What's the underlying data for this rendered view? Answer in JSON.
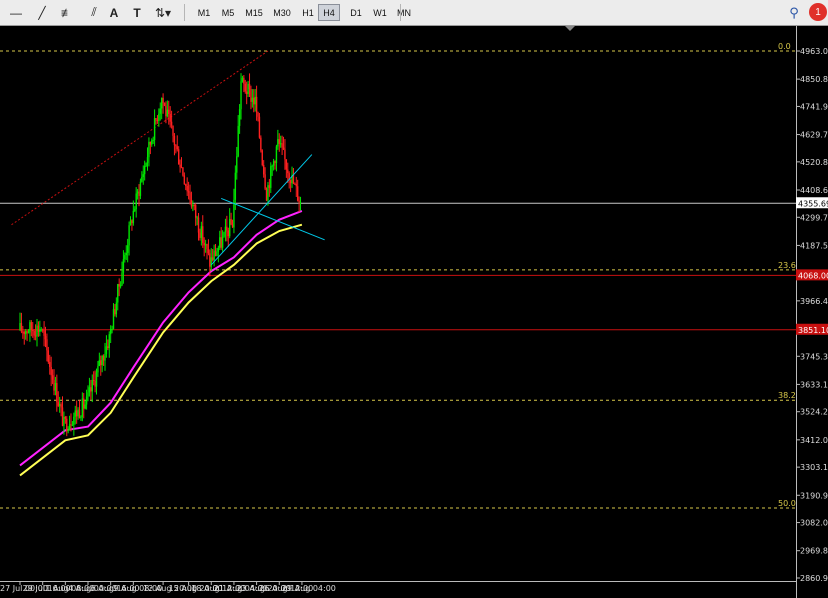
{
  "toolbar": {
    "timeframes": [
      "M1",
      "M5",
      "M15",
      "M30",
      "H1",
      "H4",
      "D1",
      "W1",
      "MN"
    ],
    "active_timeframe": "H4",
    "notification_count": "1"
  },
  "chart_data": {
    "type": "candlestick",
    "symbol_price_label": "4355.69",
    "y_ticks": [
      "4963.00",
      "4850.80",
      "4741.90",
      "4629.70",
      "4520.80",
      "4408.60",
      "4299.70",
      "4187.50",
      "4075.30",
      "3966.40",
      "3854.20",
      "3745.30",
      "3633.10",
      "3524.20",
      "3412.00",
      "3303.10",
      "3190.90",
      "3082.00",
      "2969.80",
      "2860.90"
    ],
    "y_range": [
      2860.9,
      4963.0
    ],
    "x_ticks": [
      "27 Jul 00:00",
      "29 Jul 16:00",
      "1 Aug 08:00",
      "4 Aug 00:00",
      "6 Aug 16:00",
      "9 Aug 08:00",
      "12 Aug 20:00",
      "15 Aug 20:00",
      "18 Aug 12:00",
      "21 Aug 04:00",
      "23 Aug 20:00",
      "26 Aug 12:00",
      "29 Aug 04:00"
    ],
    "fib_levels": [
      {
        "label": "0.0",
        "price": 4963.0
      },
      {
        "label": "23.6",
        "price": 4090.0
      },
      {
        "label": "38.2",
        "price": 3570.0
      },
      {
        "label": "50.0",
        "price": 3140.0
      }
    ],
    "horizontal_lines": [
      {
        "price": 4355.69,
        "color": "#c8c8c8",
        "label": "4355.69",
        "tag_bg": "#ffffff",
        "tag_fg": "#000000"
      },
      {
        "price": 4068.0,
        "color": "#c81010",
        "label": "4068.00",
        "tag_bg": "#c81010",
        "tag_fg": "#ffffff"
      },
      {
        "price": 3851.1,
        "color": "#c81010",
        "label": "3851.10",
        "tag_bg": "#c81010",
        "tag_fg": "#ffffff"
      }
    ],
    "colors": {
      "bull": "#00e600",
      "bear": "#ff2020",
      "ma_fast": "#ff22ff",
      "ma_slow": "#ffff55",
      "trend": "#00c8e8",
      "channel": "#c81010",
      "fib": "#d8c84a"
    },
    "key_points": [
      {
        "date": "27 Jul 00:00",
        "price": 3850
      },
      {
        "date": "29 Jul 16:00",
        "price": 3860
      },
      {
        "date": "1 Aug 08:00",
        "price": 3470
      },
      {
        "date": "4 Aug 00:00",
        "price": 3560
      },
      {
        "date": "6 Aug 16:00",
        "price": 3820
      },
      {
        "date": "9 Aug 08:00",
        "price": 4300
      },
      {
        "date": "12 Aug 20:00",
        "price": 4780
      },
      {
        "date": "15 Aug 20:00",
        "price": 4420
      },
      {
        "date": "18 Aug 12:00",
        "price": 4120
      },
      {
        "date": "21 Aug 04:00",
        "price": 4280
      },
      {
        "date": "22 Aug 04:00",
        "price": 4840
      },
      {
        "date": "23 Aug 20:00",
        "price": 4760
      },
      {
        "date": "25 Aug 04:00",
        "price": 4400
      },
      {
        "date": "26 Aug 12:00",
        "price": 4600
      },
      {
        "date": "29 Aug 04:00",
        "price": 4360
      }
    ],
    "ma_fast_points": [
      {
        "date": "27 Jul 00:00",
        "price": 3310
      },
      {
        "date": "1 Aug 08:00",
        "price": 3450
      },
      {
        "date": "4 Aug 00:00",
        "price": 3465
      },
      {
        "date": "6 Aug 16:00",
        "price": 3560
      },
      {
        "date": "9 Aug 08:00",
        "price": 3700
      },
      {
        "date": "12 Aug 20:00",
        "price": 3880
      },
      {
        "date": "15 Aug 20:00",
        "price": 4000
      },
      {
        "date": "18 Aug 12:00",
        "price": 4085
      },
      {
        "date": "21 Aug 04:00",
        "price": 4140
      },
      {
        "date": "23 Aug 20:00",
        "price": 4230
      },
      {
        "date": "26 Aug 12:00",
        "price": 4290
      },
      {
        "date": "29 Aug 04:00",
        "price": 4325
      }
    ],
    "ma_slow_points": [
      {
        "date": "27 Jul 00:00",
        "price": 3270
      },
      {
        "date": "1 Aug 08:00",
        "price": 3410
      },
      {
        "date": "4 Aug 00:00",
        "price": 3430
      },
      {
        "date": "6 Aug 16:00",
        "price": 3520
      },
      {
        "date": "9 Aug 08:00",
        "price": 3660
      },
      {
        "date": "12 Aug 20:00",
        "price": 3840
      },
      {
        "date": "15 Aug 20:00",
        "price": 3960
      },
      {
        "date": "18 Aug 12:00",
        "price": 4045
      },
      {
        "date": "21 Aug 04:00",
        "price": 4110
      },
      {
        "date": "23 Aug 20:00",
        "price": 4195
      },
      {
        "date": "26 Aug 12:00",
        "price": 4245
      },
      {
        "date": "29 Aug 04:00",
        "price": 4270
      }
    ],
    "trendlines": [
      {
        "from": {
          "date": "18 Aug 12:00",
          "price": 4110
        },
        "to": {
          "date": "30 Aug 08:00",
          "price": 4550
        },
        "color": "#00c8e8"
      },
      {
        "from": {
          "date": "19 Aug 16:00",
          "price": 4375
        },
        "to": {
          "date": "31 Aug 20:00",
          "price": 4210
        },
        "color": "#00c8e8"
      },
      {
        "from": {
          "date": "26 Jul 00:00",
          "price": 4270
        },
        "to": {
          "date": "25 Aug 04:00",
          "price": 4963
        },
        "color": "#c81010"
      }
    ]
  }
}
